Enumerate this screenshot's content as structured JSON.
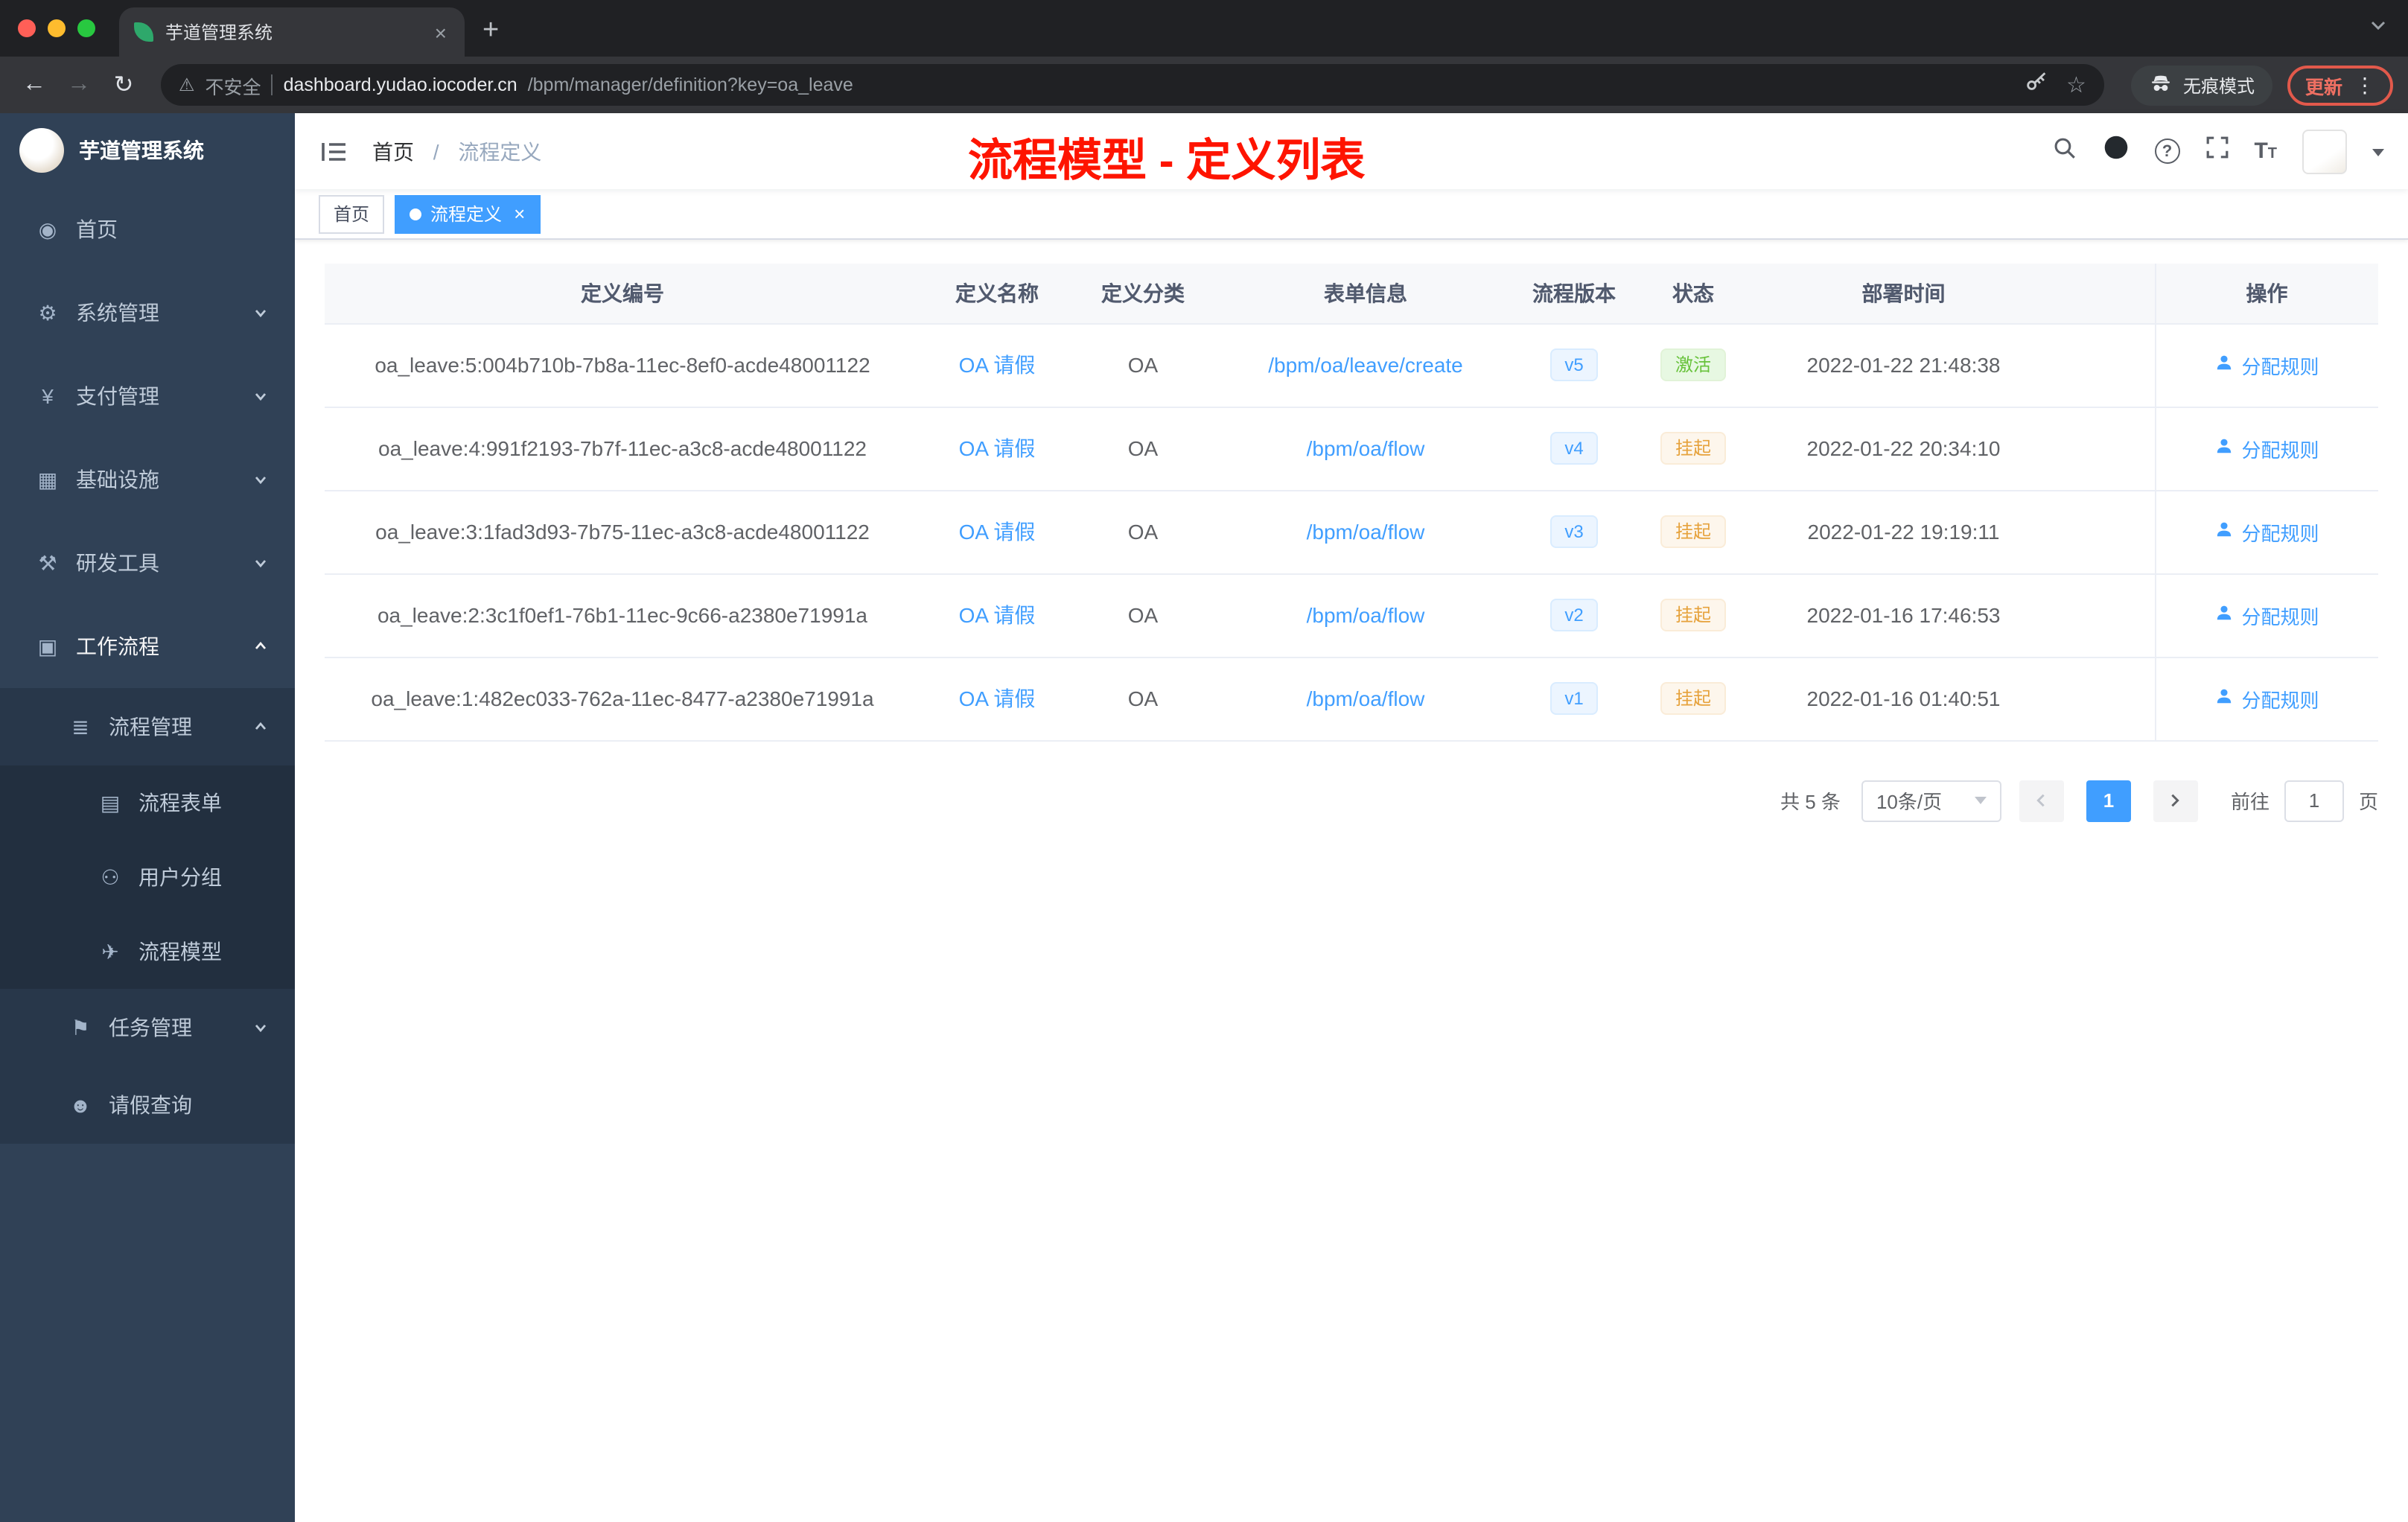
{
  "browser": {
    "tab_title": "芋道管理系统",
    "security_label": "不安全",
    "url_host": "dashboard.yudao.iocoder.cn",
    "url_path": "/bpm/manager/definition?key=oa_leave",
    "incognito_label": "无痕模式",
    "update_label": "更新"
  },
  "sidebar": {
    "brand": "芋道管理系统",
    "items": [
      {
        "label": "首页",
        "icon": "home-icon",
        "glyph": "◉",
        "level": 1
      },
      {
        "label": "系统管理",
        "icon": "gear-icon",
        "glyph": "⚙",
        "level": 1,
        "chevron": "down"
      },
      {
        "label": "支付管理",
        "icon": "payment-icon",
        "glyph": "¥",
        "level": 1,
        "chevron": "down"
      },
      {
        "label": "基础设施",
        "icon": "infrastructure-icon",
        "glyph": "▦",
        "level": 1,
        "chevron": "down"
      },
      {
        "label": "研发工具",
        "icon": "devtools-icon",
        "glyph": "⚒",
        "level": 1,
        "chevron": "down"
      },
      {
        "label": "工作流程",
        "icon": "workflow-icon",
        "glyph": "▣",
        "level": 1,
        "chevron": "up",
        "active": true
      },
      {
        "label": "流程管理",
        "icon": "process-manage-icon",
        "glyph": "≣",
        "level": 2,
        "chevron": "up"
      },
      {
        "label": "流程表单",
        "icon": "process-form-icon",
        "glyph": "▤",
        "level": 3
      },
      {
        "label": "用户分组",
        "icon": "user-group-icon",
        "glyph": "⚇",
        "level": 3
      },
      {
        "label": "流程模型",
        "icon": "process-model-icon",
        "glyph": "✈",
        "level": 3
      },
      {
        "label": "任务管理",
        "icon": "task-manage-icon",
        "glyph": "⚑",
        "level": 2,
        "chevron": "down"
      },
      {
        "label": "请假查询",
        "icon": "leave-query-icon",
        "glyph": "☻",
        "level": 2
      }
    ]
  },
  "header": {
    "breadcrumb": {
      "root": "首页",
      "separator": "/",
      "current": "流程定义"
    },
    "annotation": "流程模型 - 定义列表"
  },
  "tags": [
    {
      "label": "首页",
      "active": false
    },
    {
      "label": "流程定义",
      "active": true
    }
  ],
  "table": {
    "columns": [
      "定义编号",
      "定义名称",
      "定义分类",
      "表单信息",
      "流程版本",
      "状态",
      "部署时间",
      "操作"
    ],
    "action_label": "分配规则",
    "rows": [
      {
        "id": "oa_leave:5:004b710b-7b8a-11ec-8ef0-acde48001122",
        "name": "OA 请假",
        "category": "OA",
        "form": "/bpm/oa/leave/create",
        "version": "v5",
        "status": "激活",
        "status_type": "success",
        "deploy_time": "2022-01-22 21:48:38"
      },
      {
        "id": "oa_leave:4:991f2193-7b7f-11ec-a3c8-acde48001122",
        "name": "OA 请假",
        "category": "OA",
        "form": "/bpm/oa/flow",
        "version": "v4",
        "status": "挂起",
        "status_type": "warning",
        "deploy_time": "2022-01-22 20:34:10"
      },
      {
        "id": "oa_leave:3:1fad3d93-7b75-11ec-a3c8-acde48001122",
        "name": "OA 请假",
        "category": "OA",
        "form": "/bpm/oa/flow",
        "version": "v3",
        "status": "挂起",
        "status_type": "warning",
        "deploy_time": "2022-01-22 19:19:11"
      },
      {
        "id": "oa_leave:2:3c1f0ef1-76b1-11ec-9c66-a2380e71991a",
        "name": "OA 请假",
        "category": "OA",
        "form": "/bpm/oa/flow",
        "version": "v2",
        "status": "挂起",
        "status_type": "warning",
        "deploy_time": "2022-01-16 17:46:53"
      },
      {
        "id": "oa_leave:1:482ec033-762a-11ec-8477-a2380e71991a",
        "name": "OA 请假",
        "category": "OA",
        "form": "/bpm/oa/flow",
        "version": "v1",
        "status": "挂起",
        "status_type": "warning",
        "deploy_time": "2022-01-16 01:40:51"
      }
    ]
  },
  "pagination": {
    "total": "共 5 条",
    "page_size": "10条/页",
    "current": "1",
    "goto": "前往",
    "unit": "页",
    "goto_value": "1"
  },
  "colors": {
    "accent": "#409eff",
    "sidebar_bg": "#304156",
    "success": "#67c23a",
    "warning": "#e6a23c",
    "annotation_red": "#fe1400"
  }
}
